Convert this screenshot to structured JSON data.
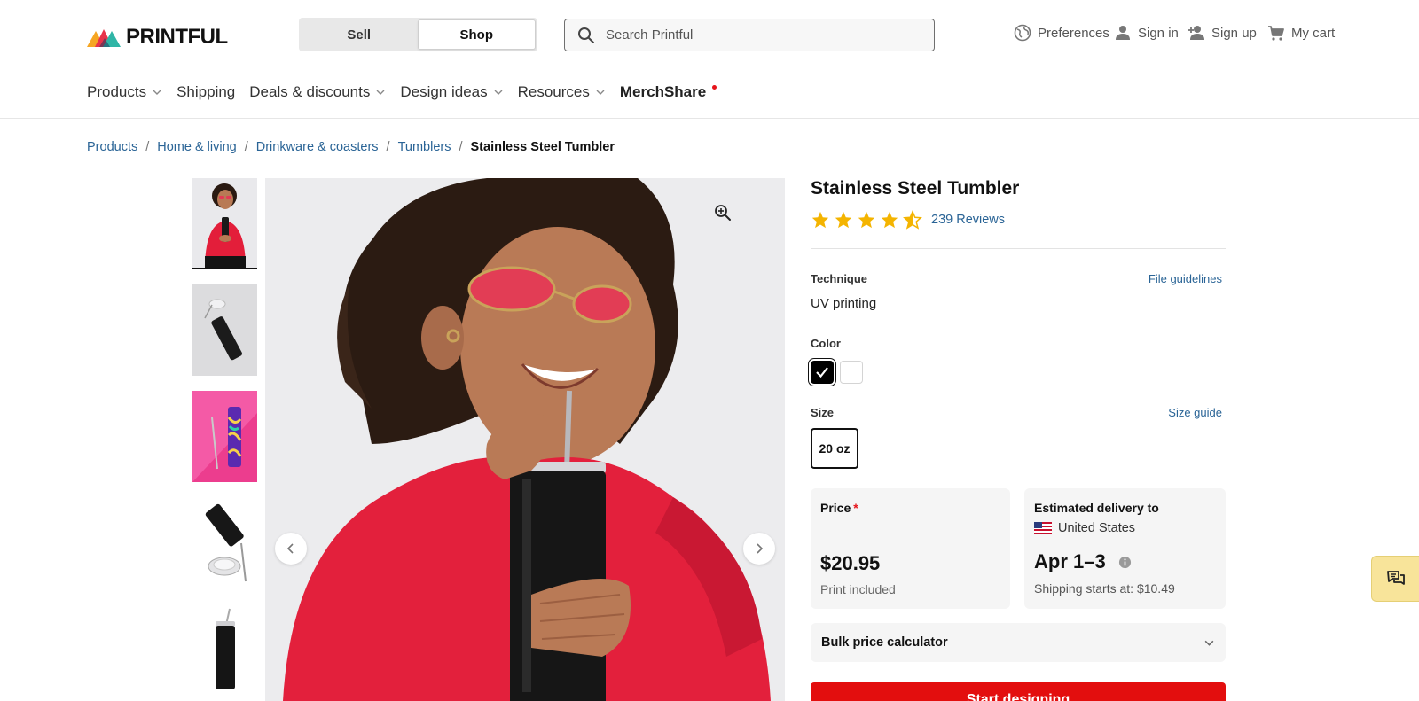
{
  "header": {
    "logo_text": "PRINTFUL",
    "mode_toggle": {
      "sell_label": "Sell",
      "shop_label": "Shop",
      "active": "Shop"
    },
    "search": {
      "placeholder": "Search Printful"
    },
    "utility": {
      "preferences": "Preferences",
      "sign_in": "Sign in",
      "sign_up": "Sign up",
      "cart": "My cart"
    }
  },
  "nav": {
    "products": "Products",
    "shipping": "Shipping",
    "deals": "Deals & discounts",
    "design_ideas": "Design ideas",
    "resources": "Resources",
    "merchshare": "MerchShare"
  },
  "breadcrumb": {
    "items": [
      "Products",
      "Home & living",
      "Drinkware & coasters",
      "Tumblers"
    ],
    "current": "Stainless Steel Tumbler"
  },
  "product": {
    "title": "Stainless Steel Tumbler",
    "rating": 4.5,
    "reviews_label": "239 Reviews",
    "technique_label": "Technique",
    "file_guidelines": "File guidelines",
    "technique_value": "UV printing",
    "color_label": "Color",
    "colors": [
      "Black",
      "White"
    ],
    "selected_color": "Black",
    "size_label": "Size",
    "size_guide": "Size guide",
    "sizes": [
      "20 oz"
    ],
    "selected_size": "20 oz"
  },
  "pricing": {
    "price_label": "Price",
    "required_mark": "*",
    "price_value": "$20.95",
    "price_sub": "Print included",
    "delivery_label": "Estimated delivery to",
    "country": "United States",
    "delivery_date": "Apr 1–3",
    "shipping_text": "Shipping starts at: $10.49",
    "bulk_label": "Bulk price calculator"
  },
  "cta": {
    "label": "Start designing"
  },
  "colors": {
    "accent_red": "#e30e0e",
    "link_blue": "#2a6496",
    "star_yellow": "#f4b400",
    "chat_bg": "#f8e49a"
  }
}
